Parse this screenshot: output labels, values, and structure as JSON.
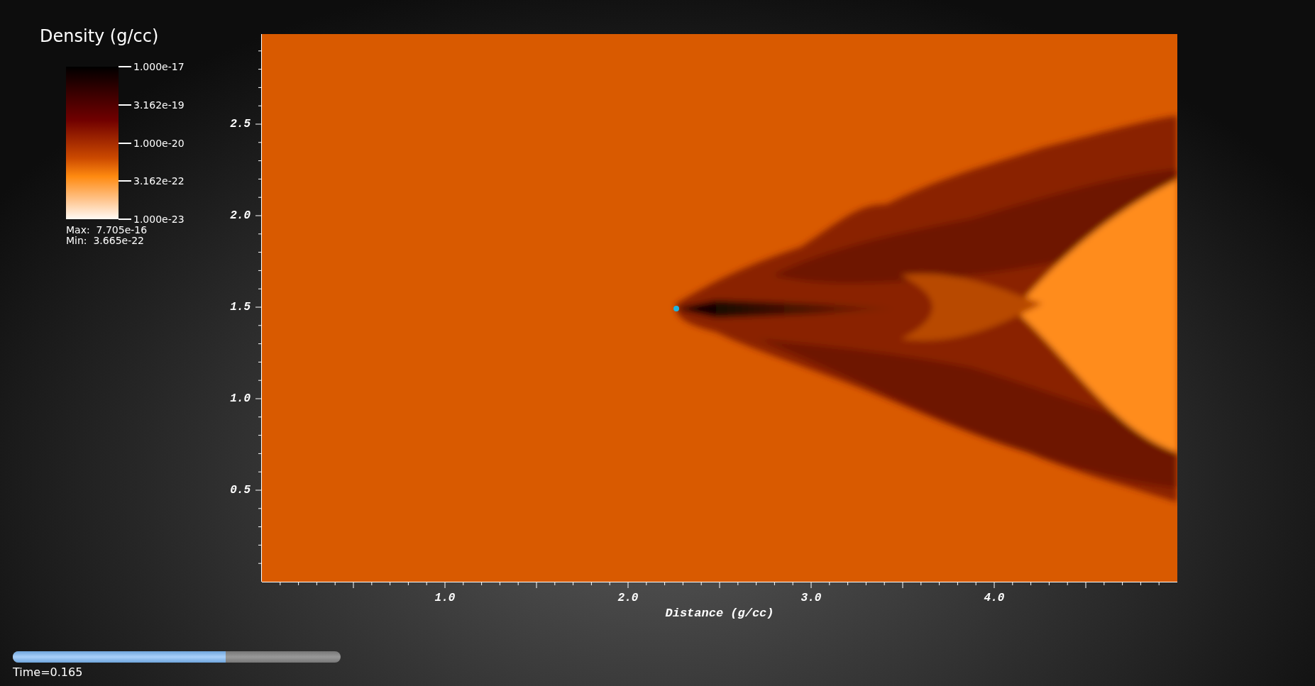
{
  "legend": {
    "title": "Density (g/cc)",
    "labels": [
      "1.000e-17",
      "3.162e-19",
      "1.000e-20",
      "3.162e-22",
      "1.000e-23"
    ],
    "max": "Max:  7.705e-16",
    "min": "Min:  3.665e-22"
  },
  "plot": {
    "xlabel": "Distance (g/cc)",
    "xticks": [
      "1.0",
      "2.0",
      "3.0",
      "4.0"
    ],
    "yticks": [
      "2.5",
      "2.0",
      "1.5",
      "1.0",
      "0.5"
    ]
  },
  "time": {
    "level": 0.65,
    "label": "Time=0.165"
  }
}
